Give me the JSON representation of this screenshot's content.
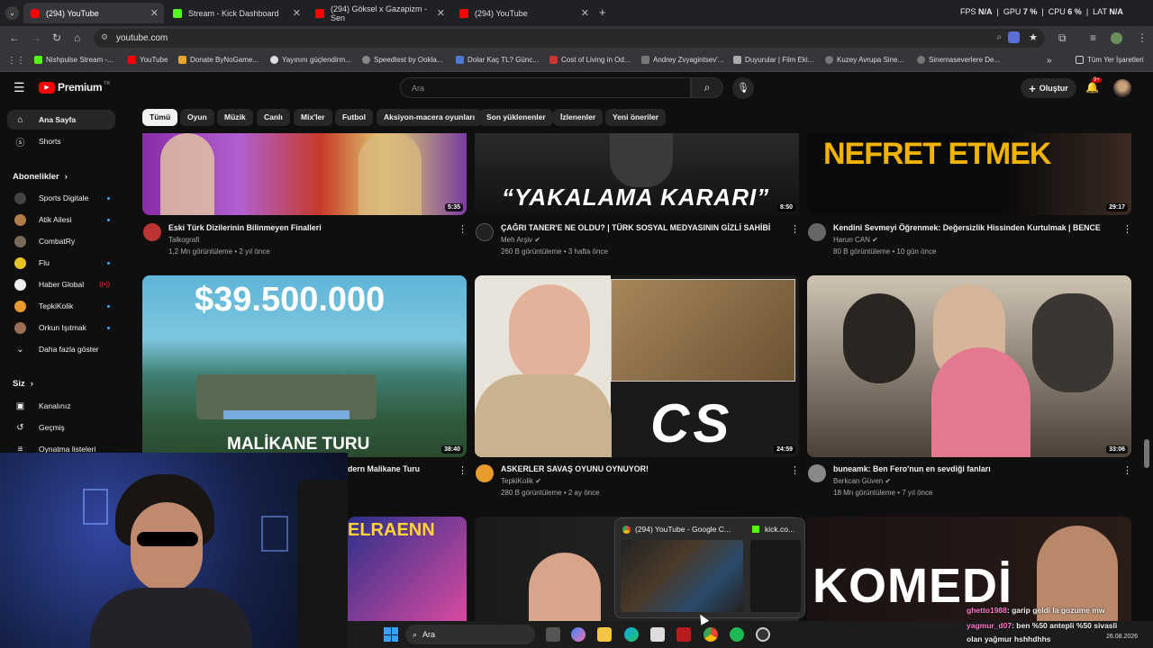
{
  "browser": {
    "tabs": [
      {
        "title": "(294) YouTube",
        "active": true
      },
      {
        "title": "Stream - Kick Dashboard",
        "active": false
      },
      {
        "title": "(294) Göksel x Gazapizm - Sen",
        "active": false
      },
      {
        "title": "(294) YouTube",
        "active": false
      }
    ],
    "stats": {
      "fps_label": "FPS",
      "fps": "N/A",
      "gpu_label": "GPU",
      "gpu": "7 %",
      "cpu_label": "CPU",
      "cpu": "6 %",
      "lat_label": "LAT",
      "lat": "N/A"
    },
    "url": "youtube.com",
    "bookmarks": [
      "Nishpulse Stream -...",
      "YouTube",
      "Donate ByNoGame...",
      "Yayınını güçlendirm...",
      "Speedtest by Ookla...",
      "Dolar Kaç TL? Günc...",
      "Cost of Living in Od...",
      "Andrey Zvyagintsev'...",
      "Duyurular | Film Eki...",
      "Kuzey Avrupa Sine...",
      "Sinemaseverlere De..."
    ],
    "bookmarks_more": "Tüm Yer İşaretleri"
  },
  "youtube": {
    "logo": "Premium",
    "logo_sup": "TR",
    "search_placeholder": "Ara",
    "create_label": "Oluştur",
    "notif_count": "9+",
    "chips": [
      "Tümü",
      "Oyun",
      "Müzik",
      "Canlı",
      "Mix'ler",
      "Futbol",
      "Aksiyon-macera oyunları",
      "Son yüklenenler",
      "İzlenenler",
      "Yeni öneriler"
    ],
    "sidebar": {
      "home": "Ana Sayfa",
      "shorts": "Shorts",
      "subs_header": "Abonelikler",
      "subs": [
        "Sports Digitale",
        "Atik Ailesi",
        "CombatRy",
        "Flu",
        "Haber Global",
        "TepkiKolik",
        "Orkun Işıtmak"
      ],
      "show_more": "Daha fazla göster",
      "you_header": "Siz",
      "you": [
        "Kanalınız",
        "Geçmiş",
        "Oynatma listeleri"
      ]
    },
    "videos": [
      {
        "title": "Eski Türk Dizilerinin Bilinmeyen Finalleri",
        "channel": "Talkografi",
        "views": "1,2 Mn görüntüleme",
        "age": "2 yıl önce",
        "duration": "5:35"
      },
      {
        "title": "ÇAĞRI TANER'E NE OLDU? | TÜRK SOSYAL MEDYASININ GİZLİ SAHİBİ",
        "channel": "Meh Arşiv",
        "views": "260 B görüntüleme",
        "age": "3 hafta önce",
        "duration": "8:50",
        "overlay": "“YAKALAMA KARARI”"
      },
      {
        "title": "Kendini Sevmeyi Öğrenmek: Değersizlik Hissinden Kurtulmak | BENCE",
        "channel": "Harun CAN",
        "views": "80 B görüntüleme",
        "age": "10 gün önce",
        "duration": "29:17",
        "overlay": "NEFRET ETMEK"
      },
      {
        "title": "dern Malikane Turu",
        "duration": "38:40",
        "overlay_top": "$39.500.000",
        "overlay_bottom": "MALİKANE TURU"
      },
      {
        "title": "ASKERLER SAVAŞ OYUNU OYNUYOR!",
        "channel": "TepkiKolik",
        "views": "280 B görüntüleme",
        "age": "2 ay önce",
        "duration": "24:59",
        "overlay": "CS"
      },
      {
        "title": "buneamk: Ben Fero'nun en sevdiği fanları",
        "channel": "Berkcan Güven",
        "views": "18 Mn görüntüleme",
        "age": "7 yıl önce",
        "duration": "33:06"
      },
      {
        "overlay": "ELRAENN"
      },
      {
        "overlay": "KOMEDİ"
      }
    ]
  },
  "taskbar": {
    "search": "Ara",
    "popup_title": "(294) YouTube - Google C...",
    "popup_title2": "kick.co...",
    "chat": [
      {
        "user": "ghetto1988",
        "msg": ": garip geldi la gozume mw"
      },
      {
        "user": "yagmur_d07",
        "msg": ": ben %50 antepli %50 sivasli"
      },
      {
        "user": "",
        "msg": "olan yağmur hshhdhhs"
      }
    ],
    "date": "26.08.2026"
  },
  "colors": {
    "accent": "#3ea6ff",
    "yt_red": "#ff0000",
    "kick_green": "#53fc18"
  }
}
